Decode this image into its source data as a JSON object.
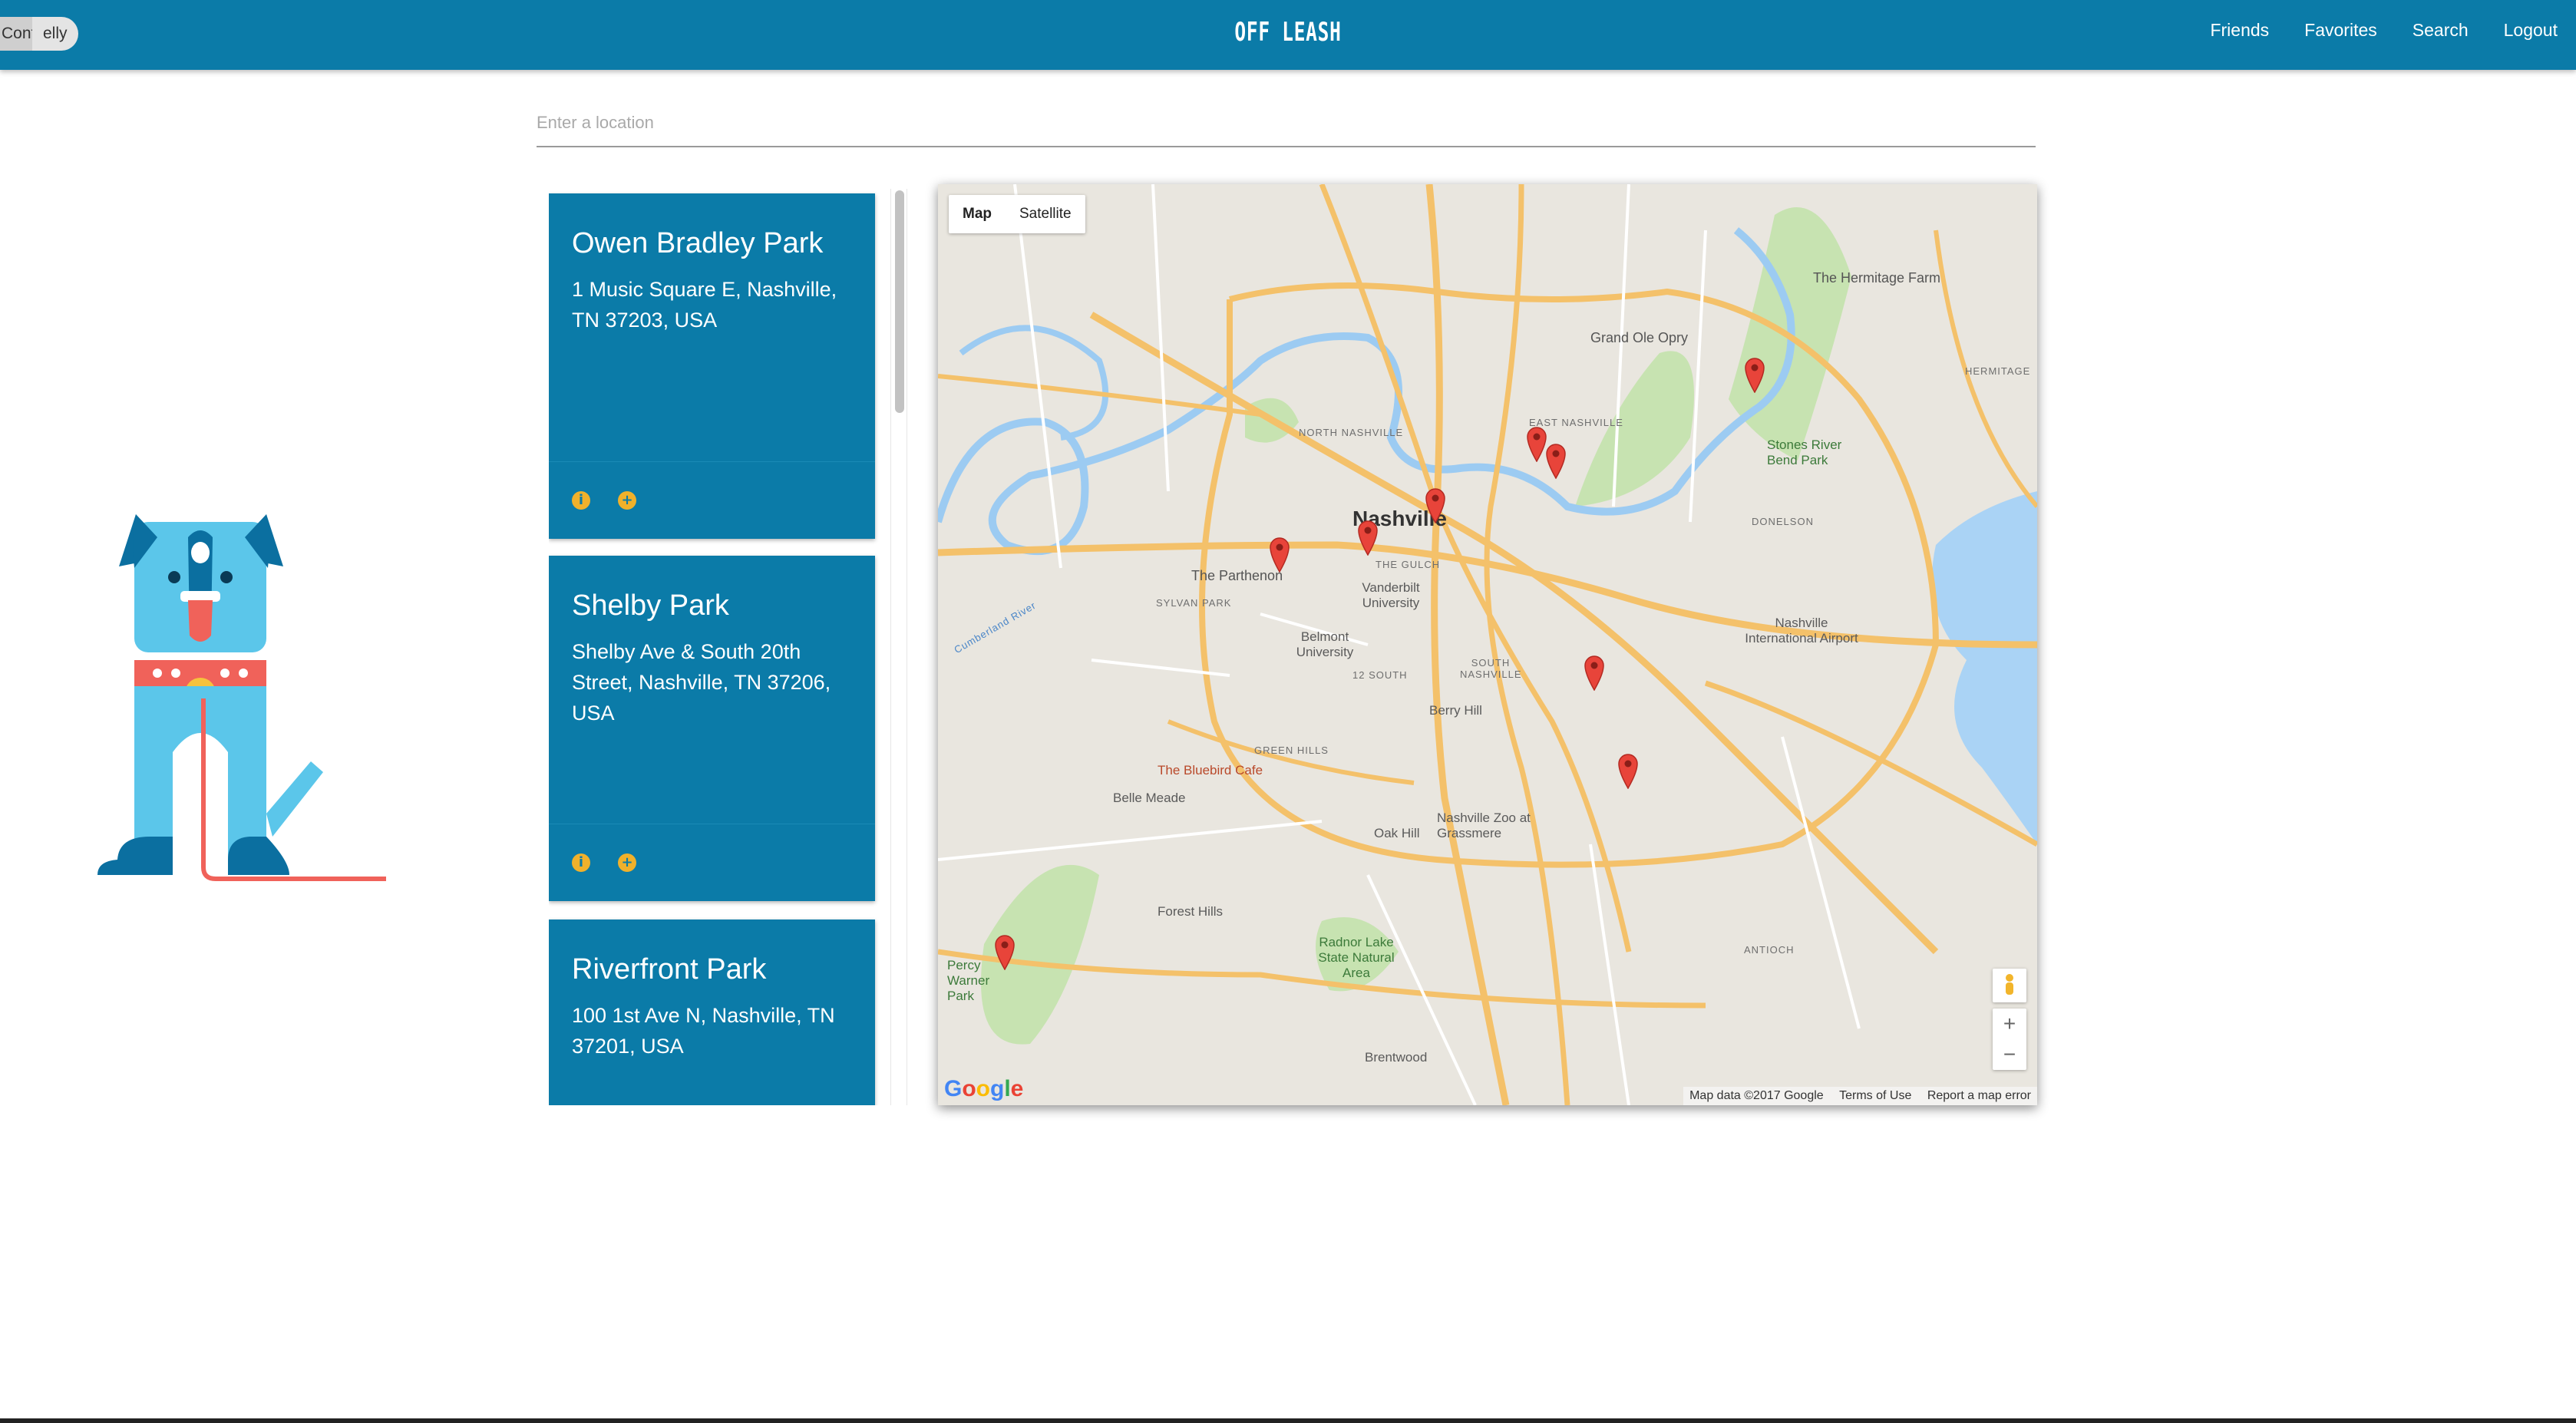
{
  "nav": {
    "user_chip_left": "Cont",
    "user_chip_right": "elly",
    "brand": "OFF LEASH",
    "links": [
      "Friends",
      "Favorites",
      "Search",
      "Logout"
    ],
    "color": "#0b7ba8"
  },
  "search": {
    "placeholder": "Enter a location",
    "value": ""
  },
  "parks": [
    {
      "name": "Owen Bradley Park",
      "address": "1 Music Square E, Nashville, TN 37203, USA"
    },
    {
      "name": "Shelby Park",
      "address": "Shelby Ave & South 20th Street, Nashville, TN 37206, USA"
    },
    {
      "name": "Riverfront Park",
      "address": "100 1st Ave N, Nashville, TN 37201, USA"
    }
  ],
  "card_icons": {
    "info": "info-icon",
    "add": "add-icon",
    "accent": "#f0b12b"
  },
  "map": {
    "type_buttons": [
      "Map",
      "Satellite"
    ],
    "selected_type": "Map",
    "zoom_in": "+",
    "zoom_out": "−",
    "footer": [
      "Map data ©2017 Google",
      "Terms of Use",
      "Report a map error"
    ],
    "logo": "Google",
    "labels": {
      "nashville": "Nashville",
      "hermitage_farm": "The Hermitage Farm",
      "grand_ole_opry": "Grand Ole Opry",
      "east_nashville": "EAST NASHVILLE",
      "north_nashville": "NORTH NASHVILLE",
      "stones_river": "Stones River Bend Park",
      "hermitage": "HERMITAGE",
      "donelson": "DONELSON",
      "airport": "Nashville International Airport",
      "the_gulch": "THE GULCH",
      "parthenon": "The Parthenon",
      "vanderbilt": "Vanderbilt University",
      "sylvan_park": "SYLVAN PARK",
      "belmont": "Belmont University",
      "twelve_south": "12 SOUTH",
      "south_nashville": "SOUTH NASHVILLE",
      "berry_hill": "Berry Hill",
      "green_hills": "GREEN HILLS",
      "bluebird": "The Bluebird Cafe",
      "belle_meade": "Belle Meade",
      "oak_hill": "Oak Hill",
      "zoo": "Nashville Zoo at Grassmere",
      "forest_hills": "Forest Hills",
      "radnor": "Radnor Lake State Natural Area",
      "brentwood": "Brentwood",
      "antioch": "ANTIOCH",
      "percy_warner": "Percy Warner Park",
      "cumberland_river": "Cumberland River"
    },
    "marker_color": "#e8443a"
  }
}
